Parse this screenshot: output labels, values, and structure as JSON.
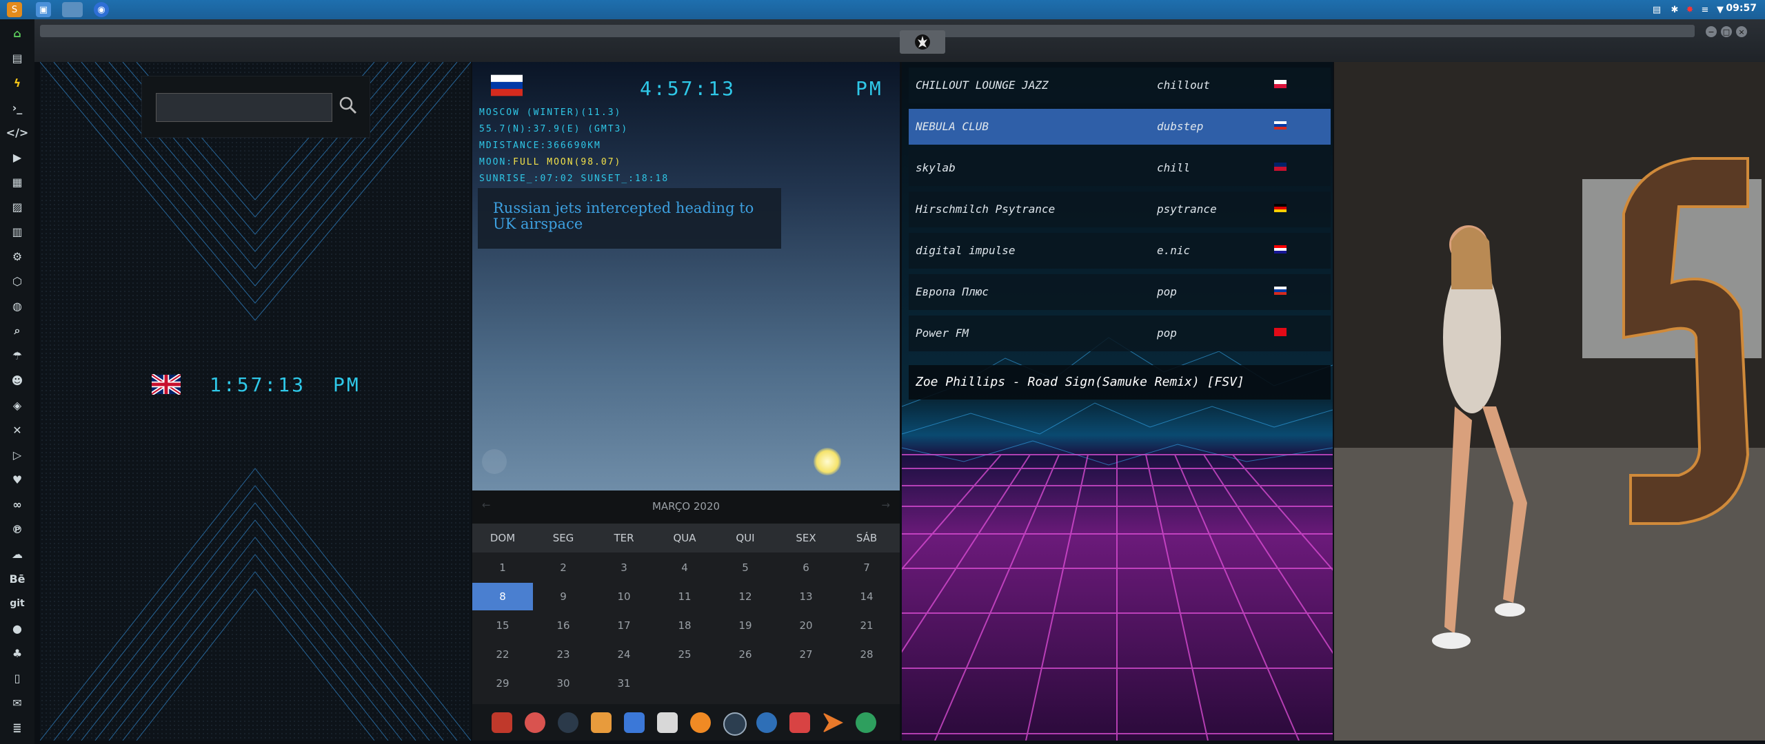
{
  "taskbar": {
    "clock": "09:57"
  },
  "world_clock": {
    "time": "1:57:13",
    "ampm": "PM",
    "flag": "uk"
  },
  "weather": {
    "time": "4:57:13",
    "ampm": "PM",
    "flag": "russia",
    "lines": [
      "MOSCOW (WINTER)(11.3)",
      "55.7(N):37.9(E) (GMT3)",
      "MDISTANCE:366690KM",
      "SUNRISE_:07:02 SUNSET_:18:18"
    ],
    "moon_label": "MOON:",
    "moon_value": "FULL MOON(98.07)",
    "news": "Russian jets intercepted heading to UK airspace"
  },
  "calendar": {
    "month": "MARÇO 2020",
    "weekdays": [
      "DOM",
      "SEG",
      "TER",
      "QUA",
      "QUI",
      "SEX",
      "SÁB"
    ],
    "days": [
      "1",
      "2",
      "3",
      "4",
      "5",
      "6",
      "7",
      "8",
      "9",
      "10",
      "11",
      "12",
      "13",
      "14",
      "15",
      "16",
      "17",
      "18",
      "19",
      "20",
      "21",
      "22",
      "23",
      "24",
      "25",
      "26",
      "27",
      "28",
      "29",
      "30",
      "31"
    ],
    "selected": "8"
  },
  "radio": {
    "stations": [
      {
        "name": "CHILLOUT LOUNGE JAZZ",
        "genre": "chillout",
        "flag": "poland"
      },
      {
        "name": "NEBULA CLUB",
        "genre": "dubstep",
        "flag": "russia"
      },
      {
        "name": "skylab",
        "genre": "chill",
        "flag": "uk"
      },
      {
        "name": "Hirschmilch Psytrance",
        "genre": "psytrance",
        "flag": "germany"
      },
      {
        "name": "digital impulse",
        "genre": "e.nic",
        "flag": "croatia"
      },
      {
        "name": "Европа Плюс",
        "genre": "pop",
        "flag": "russia"
      },
      {
        "name": "Power FM",
        "genre": "pop",
        "flag": "turkey"
      }
    ],
    "selected_index": 1,
    "now_playing": "Zoe Phillips - Road Sign(Samuke Remix) [FSV]"
  },
  "sidebar_icons": [
    "home-icon",
    "document-icon",
    "bolt-icon",
    "terminal-icon",
    "code-icon",
    "play-icon",
    "file-icon",
    "image-icon",
    "news-icon",
    "settings-icon",
    "hexagon-icon",
    "globe-icon",
    "search-icon",
    "umbrella-icon",
    "contact-icon",
    "tag-icon",
    "tools-icon",
    "youtube-icon",
    "heart-icon",
    "infinity-icon",
    "pinterest-icon",
    "cloud-icon",
    "behance-icon",
    "git-icon",
    "github-icon",
    "group-icon",
    "map-icon",
    "mail-icon",
    "storage-icon"
  ],
  "sidebar_glyphs": {
    "behance": "Bē",
    "git": "git"
  }
}
